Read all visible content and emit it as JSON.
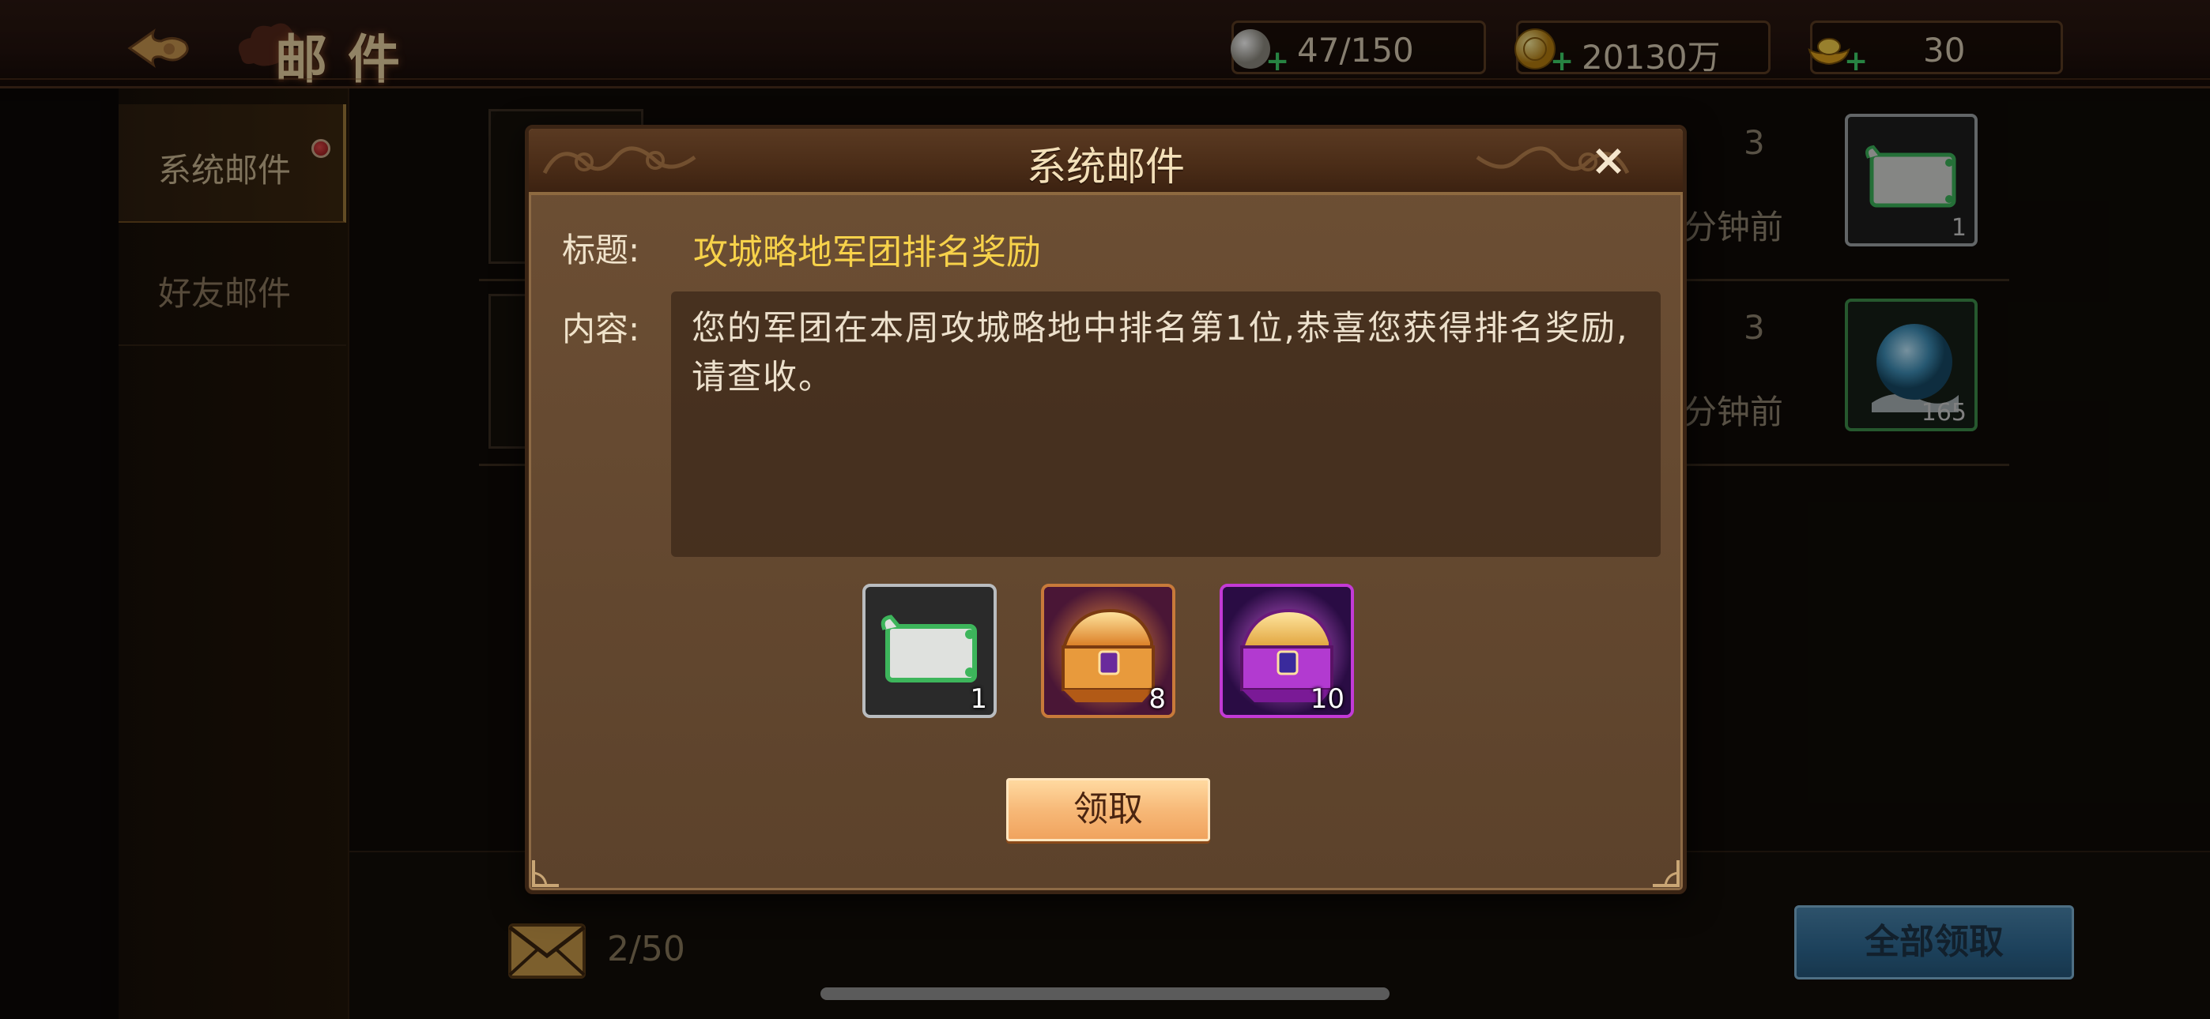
{
  "header": {
    "title": "邮件",
    "resources": {
      "pearl": "47/150",
      "gold": "20130万",
      "ingot": "30"
    }
  },
  "sidebar": {
    "tabs": [
      {
        "label": "系统邮件",
        "active": true,
        "badge": true
      },
      {
        "label": "好友邮件",
        "active": false
      }
    ]
  },
  "mail_list": [
    {
      "count": "3",
      "time": "分钟前",
      "attachment_qty": "1",
      "attachment_icon": "scroll-icon"
    },
    {
      "count": "3",
      "time": "分钟前",
      "attachment_qty": "165",
      "attachment_icon": "orb-icon"
    }
  ],
  "footer": {
    "mail_count": "2/50",
    "claim_all_label": "全部领取"
  },
  "dialog": {
    "title": "系统邮件",
    "close_label": "×",
    "subject_label": "标题:",
    "subject": "攻城略地军团排名奖励",
    "content_label": "内容:",
    "content": "您的军团在本周攻城略地中排名第1位,恭喜您获得排名奖励,请查收。",
    "rewards": [
      {
        "icon": "scroll-icon",
        "qty": "1",
        "rarity_color": "#b9bcbf"
      },
      {
        "icon": "orange-chest-icon",
        "qty": "8",
        "rarity_color": "#c87a3a"
      },
      {
        "icon": "purple-chest-icon",
        "qty": "10",
        "rarity_color": "#c33ad6"
      }
    ],
    "claim_label": "领取"
  },
  "colors": {
    "accent_gold": "#f7d24a",
    "panel_brown": "#664a31",
    "claim_orange": "#f7b978",
    "claim_all_blue": "#2f6a94"
  }
}
